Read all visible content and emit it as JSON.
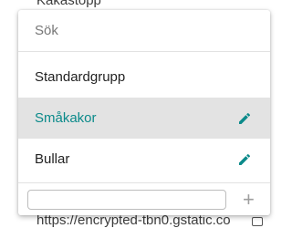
{
  "background": {
    "top_text": "Kakastopp",
    "bottom_text": "https://encrypted-tbn0.gstatic.co"
  },
  "menu": {
    "search_placeholder": "Sök",
    "items": [
      {
        "label": "Standardgrupp",
        "editable": false
      },
      {
        "label": "Småkakor",
        "editable": true,
        "selected": true
      },
      {
        "label": "Bullar",
        "editable": true
      }
    ],
    "new_group_value": "",
    "add_symbol": "+"
  },
  "colors": {
    "accent": "#0b8a8a",
    "selected_background": "#e3e3e3"
  }
}
